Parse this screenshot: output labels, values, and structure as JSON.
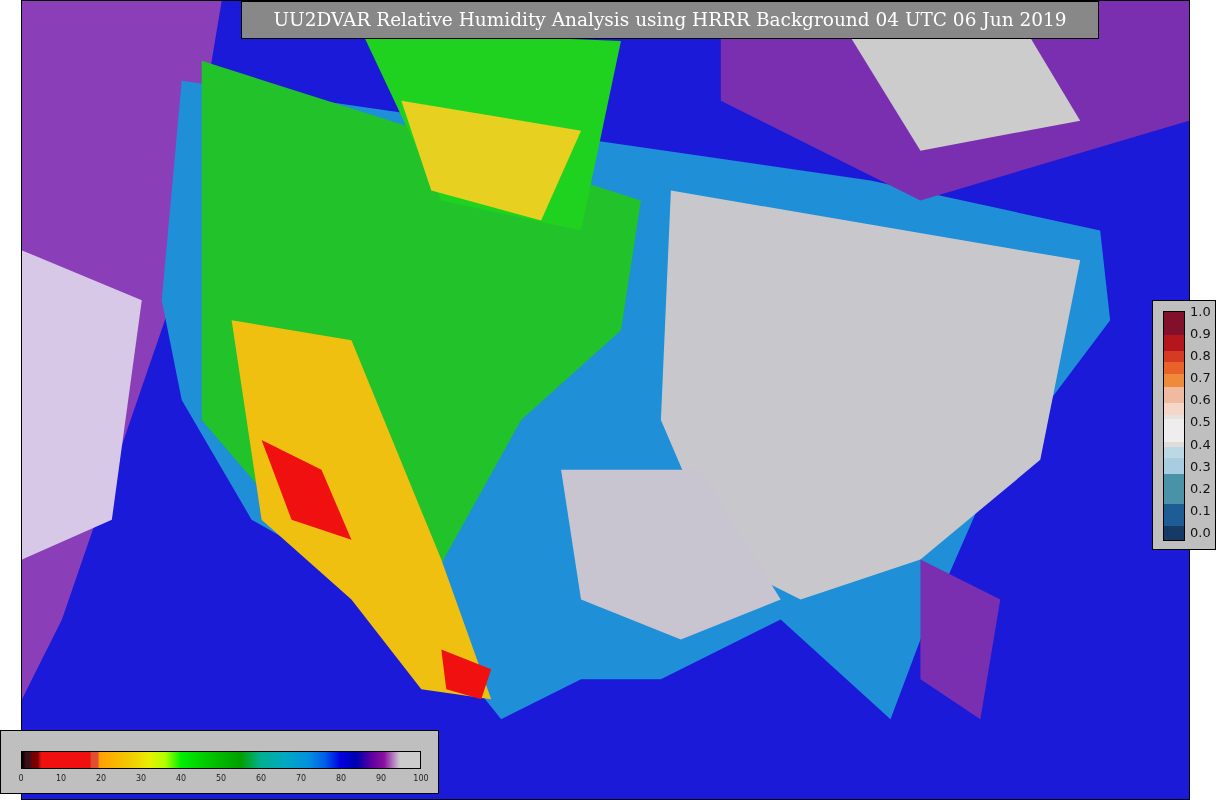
{
  "title": "UU2DVAR Relative Humidity Analysis using HRRR Background 04 UTC 06 Jun 2019",
  "humidity_colorbar": {
    "ticks": [
      "0",
      "10",
      "20",
      "30",
      "40",
      "50",
      "60",
      "70",
      "80",
      "90",
      "100"
    ]
  },
  "scale_colorbar": {
    "ticks": [
      "1.0",
      "0.9",
      "0.8",
      "0.7",
      "0.6",
      "0.5",
      "0.4",
      "0.3",
      "0.2",
      "0.1",
      "0.0"
    ]
  }
}
